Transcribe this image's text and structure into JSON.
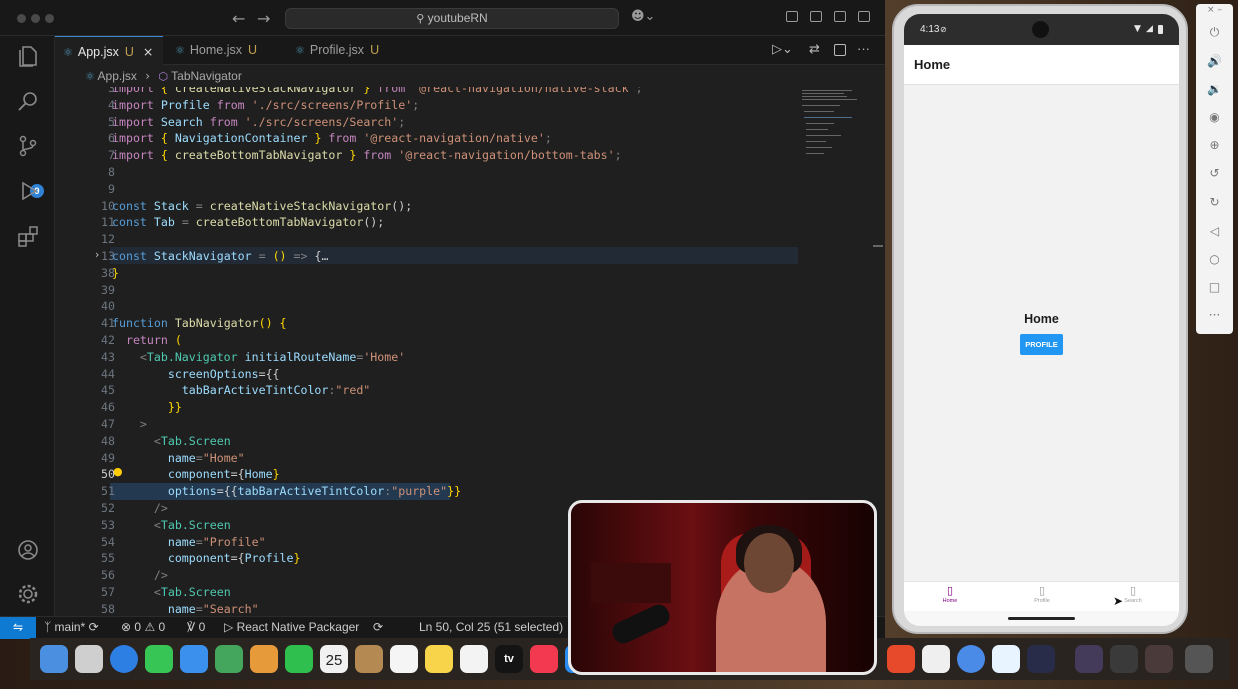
{
  "titlebar": {
    "search_text": "youtubeRN"
  },
  "scm_badge": "9",
  "tabs": [
    {
      "label": "App.jsx",
      "status": "U",
      "close": "×"
    },
    {
      "label": "Home.jsx",
      "status": "U"
    },
    {
      "label": "Profile.jsx",
      "status": "U"
    }
  ],
  "breadcrumb": {
    "file": "App.jsx",
    "symbol": "TabNavigator"
  },
  "code_lines": [
    {
      "num": "3",
      "text": "import { createNativeStackNavigator } from '@react-navigation/native-stack';"
    },
    {
      "num": "4",
      "text": "import Profile from './src/screens/Profile';"
    },
    {
      "num": "5",
      "text": "import Search from './src/screens/Search';"
    },
    {
      "num": "6",
      "text": "import { NavigationContainer } from '@react-navigation/native';"
    },
    {
      "num": "7",
      "text": "import { createBottomTabNavigator } from '@react-navigation/bottom-tabs';"
    },
    {
      "num": "8",
      "text": ""
    },
    {
      "num": "9",
      "text": ""
    },
    {
      "num": "10",
      "text": "const Stack = createNativeStackNavigator();"
    },
    {
      "num": "11",
      "text": "const Tab = createBottomTabNavigator();"
    },
    {
      "num": "12",
      "text": ""
    },
    {
      "num": "13",
      "text": "const StackNavigator = () => {…"
    },
    {
      "num": "38",
      "text": "}"
    },
    {
      "num": "39",
      "text": ""
    },
    {
      "num": "40",
      "text": ""
    },
    {
      "num": "41",
      "text": "function TabNavigator() {"
    },
    {
      "num": "42",
      "text": "  return ("
    },
    {
      "num": "43",
      "text": "    <Tab.Navigator initialRouteName='Home'"
    },
    {
      "num": "44",
      "text": "        screenOptions={{"
    },
    {
      "num": "45",
      "text": "          tabBarActiveTintColor:\"red\""
    },
    {
      "num": "46",
      "text": "        }}"
    },
    {
      "num": "47",
      "text": "    >"
    },
    {
      "num": "48",
      "text": "      <Tab.Screen"
    },
    {
      "num": "49",
      "text": "        name=\"Home\""
    },
    {
      "num": "50",
      "text": "        component={Home}"
    },
    {
      "num": "51",
      "text": "        options={{tabBarActiveTintColor:\"purple\"}}"
    },
    {
      "num": "52",
      "text": "      />"
    },
    {
      "num": "53",
      "text": "      <Tab.Screen"
    },
    {
      "num": "54",
      "text": "        name=\"Profile\""
    },
    {
      "num": "55",
      "text": "        component={Profile}"
    },
    {
      "num": "56",
      "text": "      />"
    },
    {
      "num": "57",
      "text": "      <Tab.Screen"
    },
    {
      "num": "58",
      "text": "        name=\"Search\""
    }
  ],
  "statusbar": {
    "branch": "main*",
    "errors": "0",
    "warnings": "0",
    "ports": "0",
    "task": "React Native Packager",
    "cursor": "Ln 50, Col 25 (51 selected)"
  },
  "phone": {
    "time": "4:13",
    "header_title": "Home",
    "screen_label": "Home",
    "button_label": "PROFILE",
    "tabs": [
      {
        "label": "Home",
        "active": true
      },
      {
        "label": "Profile",
        "active": false
      },
      {
        "label": "Search",
        "active": false
      }
    ]
  },
  "dock": {
    "calendar_day": "25",
    "tv_label": "tv"
  },
  "colors": {
    "accent_blue": "#0e7ad1",
    "tab_active_purple": "#800080",
    "profile_button": "#2196f3",
    "keyword": "#569cd6",
    "string": "#ce9178"
  }
}
